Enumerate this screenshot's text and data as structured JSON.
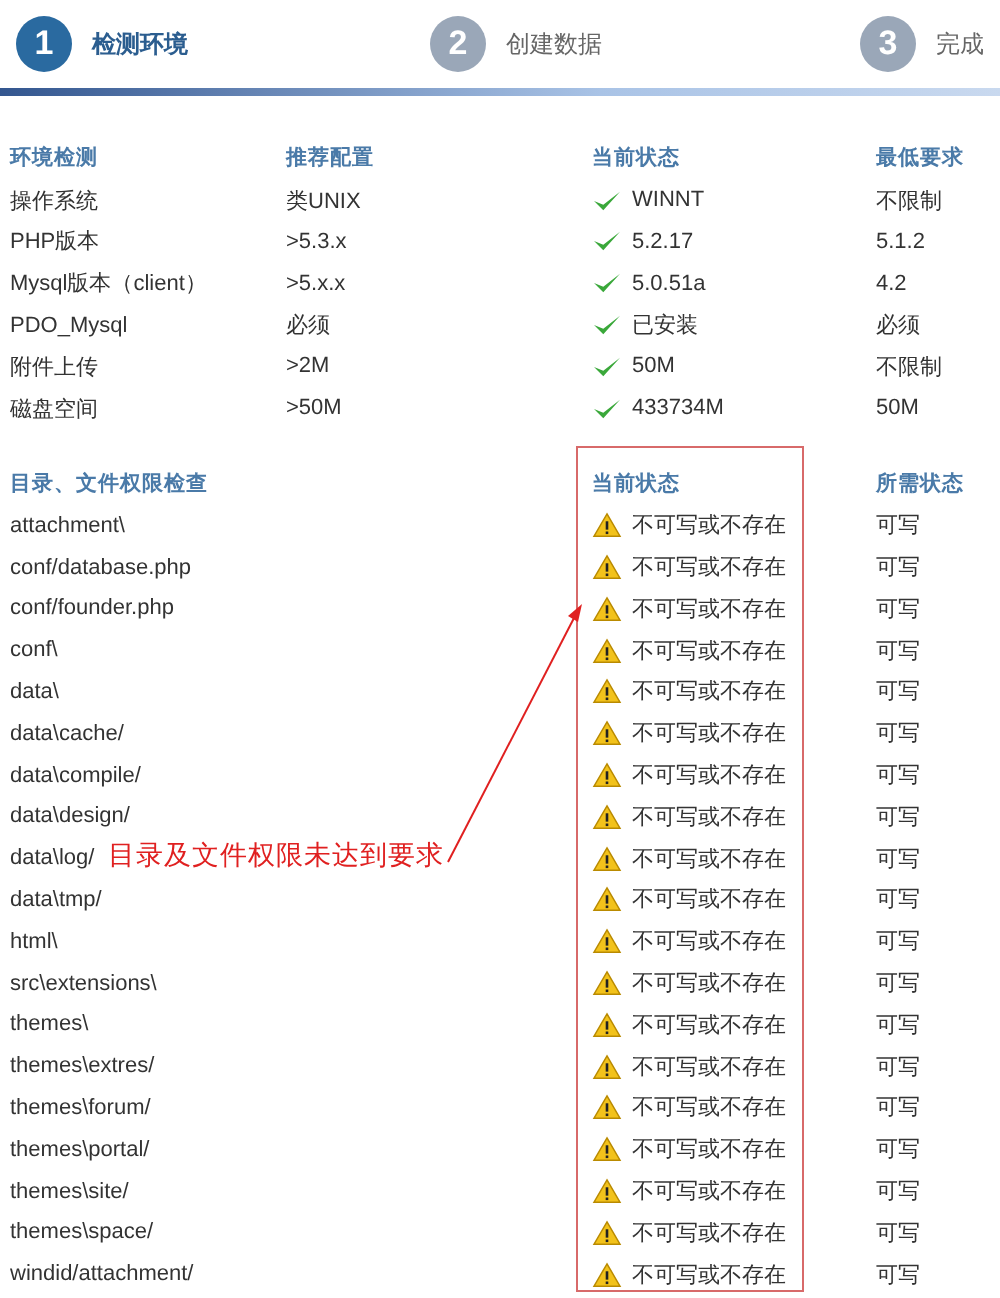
{
  "steps": [
    {
      "number": "1",
      "label": "检测环境",
      "selected": true
    },
    {
      "number": "2",
      "label": "创建数据",
      "selected": false
    },
    {
      "number": "3",
      "label": "完成",
      "selected": false
    }
  ],
  "environment": {
    "columns": [
      "环境检测",
      "推荐配置",
      "当前状态",
      "最低要求"
    ],
    "rows": [
      {
        "item": "操作系统",
        "recommended": "类UNIX",
        "current": "WINNT",
        "ok": true,
        "minimum": "不限制"
      },
      {
        "item": "PHP版本",
        "recommended": ">5.3.x",
        "current": "5.2.17",
        "ok": true,
        "minimum": "5.1.2"
      },
      {
        "item": "Mysql版本（client）",
        "recommended": ">5.x.x",
        "current": "5.0.51a",
        "ok": true,
        "minimum": "4.2"
      },
      {
        "item": "PDO_Mysql",
        "recommended": "必须",
        "current": "已安装",
        "ok": true,
        "minimum": "必须"
      },
      {
        "item": "附件上传",
        "recommended": ">2M",
        "current": "50M",
        "ok": true,
        "minimum": "不限制"
      },
      {
        "item": "磁盘空间",
        "recommended": ">50M",
        "current": "433734M",
        "ok": true,
        "minimum": "50M"
      }
    ]
  },
  "permissions": {
    "columns": [
      "目录、文件权限检查",
      "当前状态",
      "所需状态"
    ],
    "rows": [
      {
        "path": "attachment\\",
        "status": "不可写或不存在",
        "ok": false,
        "required": "可写"
      },
      {
        "path": "conf/database.php",
        "status": "不可写或不存在",
        "ok": false,
        "required": "可写"
      },
      {
        "path": "conf/founder.php",
        "status": "不可写或不存在",
        "ok": false,
        "required": "可写"
      },
      {
        "path": "conf\\",
        "status": "不可写或不存在",
        "ok": false,
        "required": "可写"
      },
      {
        "path": "data\\",
        "status": "不可写或不存在",
        "ok": false,
        "required": "可写"
      },
      {
        "path": "data\\cache/",
        "status": "不可写或不存在",
        "ok": false,
        "required": "可写"
      },
      {
        "path": "data\\compile/",
        "status": "不可写或不存在",
        "ok": false,
        "required": "可写"
      },
      {
        "path": "data\\design/",
        "status": "不可写或不存在",
        "ok": false,
        "required": "可写"
      },
      {
        "path": "data\\log/",
        "status": "不可写或不存在",
        "ok": false,
        "required": "可写"
      },
      {
        "path": "data\\tmp/",
        "status": "不可写或不存在",
        "ok": false,
        "required": "可写"
      },
      {
        "path": "html\\",
        "status": "不可写或不存在",
        "ok": false,
        "required": "可写"
      },
      {
        "path": "src\\extensions\\",
        "status": "不可写或不存在",
        "ok": false,
        "required": "可写"
      },
      {
        "path": "themes\\",
        "status": "不可写或不存在",
        "ok": false,
        "required": "可写"
      },
      {
        "path": "themes\\extres/",
        "status": "不可写或不存在",
        "ok": false,
        "required": "可写"
      },
      {
        "path": "themes\\forum/",
        "status": "不可写或不存在",
        "ok": false,
        "required": "可写"
      },
      {
        "path": "themes\\portal/",
        "status": "不可写或不存在",
        "ok": false,
        "required": "可写"
      },
      {
        "path": "themes\\site/",
        "status": "不可写或不存在",
        "ok": false,
        "required": "可写"
      },
      {
        "path": "themes\\space/",
        "status": "不可写或不存在",
        "ok": false,
        "required": "可写"
      },
      {
        "path": "windid/attachment/",
        "status": "不可写或不存在",
        "ok": false,
        "required": "可写"
      }
    ]
  },
  "annotation": {
    "text": "目录及文件权限未达到要求"
  }
}
